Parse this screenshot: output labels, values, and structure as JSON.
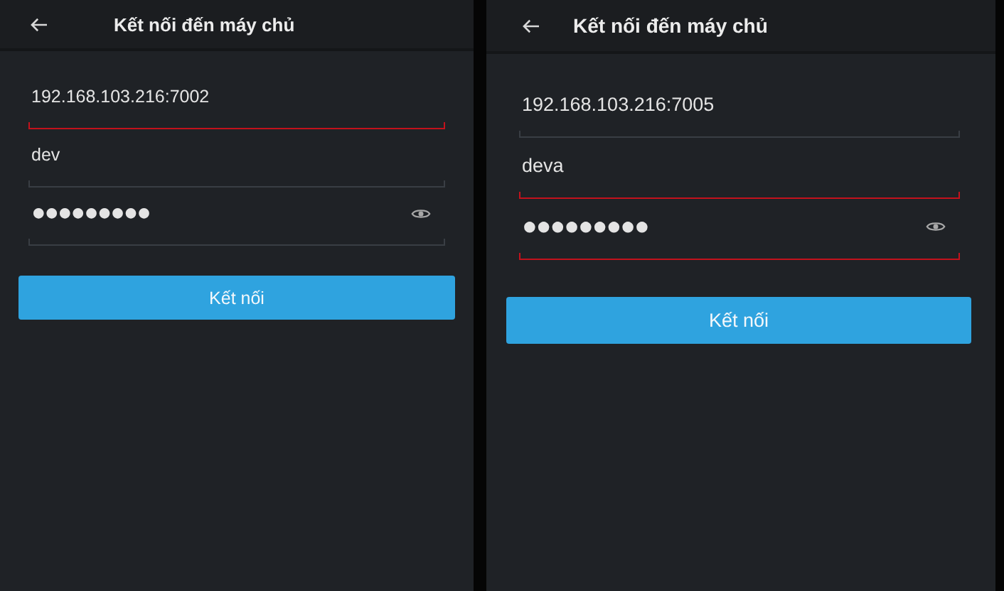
{
  "screens": [
    {
      "title": "Kết nối đến máy chủ",
      "fields": [
        {
          "kind": "text",
          "value": "192.168.103.216:7002",
          "error": true
        },
        {
          "kind": "text",
          "value": "dev",
          "error": false
        },
        {
          "kind": "password",
          "value": "●●●●●●●●●",
          "error": false
        }
      ],
      "button": "Kết nối"
    },
    {
      "title": "Kết nối đến máy chủ",
      "fields": [
        {
          "kind": "text",
          "value": "192.168.103.216:7005",
          "error": false
        },
        {
          "kind": "text",
          "value": "deva",
          "error": true
        },
        {
          "kind": "password",
          "value": "●●●●●●●●●",
          "error": true
        }
      ],
      "button": "Kết nối"
    }
  ]
}
